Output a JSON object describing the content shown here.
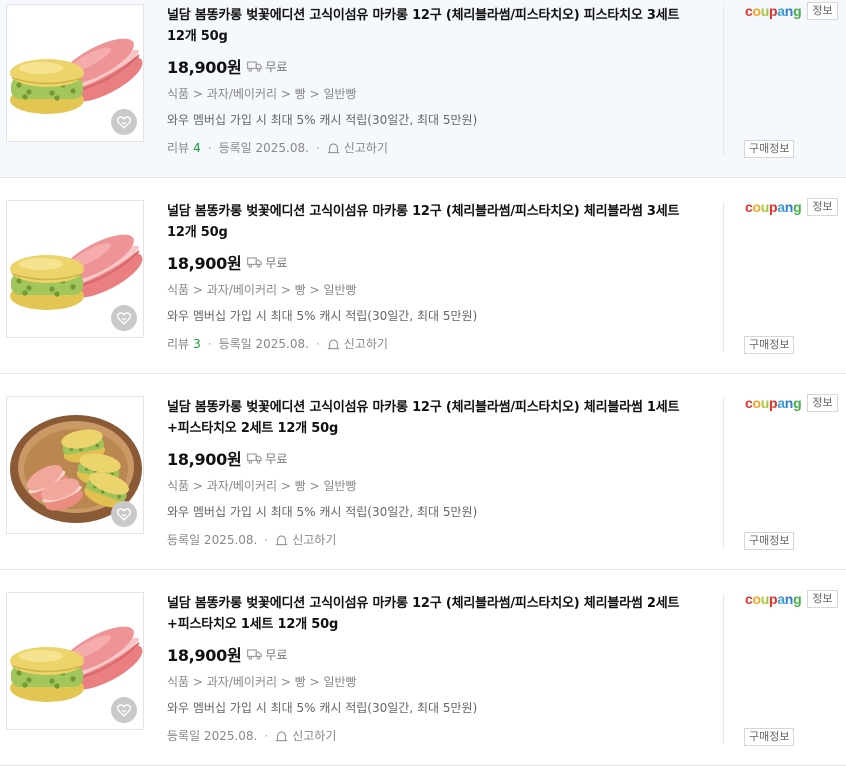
{
  "colors": {
    "price": "#111111",
    "review_count": "#1aa03a",
    "meta_text": "#888888",
    "highlight_row_bg": "#f5f8fc",
    "coupang_letters": [
      "#e0322a",
      "#f4a423",
      "#a6c63b",
      "#e0322a",
      "#3aa0d8",
      "#2f7dd1",
      "#46b04a"
    ]
  },
  "products": [
    {
      "image_icon": "macaron-stack-image",
      "zzim_icon": "heart-icon",
      "title": "널담 봄똥카롱 벚꽃에디션 고식이섬유 마카롱 12구 (체리블라썸/피스타치오) 피스타치오 3세트 12개 50g",
      "price": "18,900원",
      "shipping_icon": "truck-icon",
      "shipping": "무료",
      "category": [
        "식품",
        "과자/베이커리",
        "빵",
        "일반빵"
      ],
      "category_sep": ">",
      "benefit": "와우 멤버십 가입 시 최대 5% 캐시 적립(30일간, 최대 5만원)",
      "review_label": "리뷰",
      "review_count": "4",
      "registered": "등록일 2025.08.",
      "report": "신고하기",
      "mall_name": "coupang",
      "info_badge": "정보",
      "buy_info": "구매정보"
    },
    {
      "image_icon": "macaron-stack-image",
      "zzim_icon": "heart-icon",
      "title": "널담 봄똥카롱 벚꽃에디션 고식이섬유 마카롱 12구 (체리블라썸/피스타치오) 체리블라썸 3세트 12개 50g",
      "price": "18,900원",
      "shipping_icon": "truck-icon",
      "shipping": "무료",
      "category": [
        "식품",
        "과자/베이커리",
        "빵",
        "일반빵"
      ],
      "category_sep": ">",
      "benefit": "와우 멤버십 가입 시 최대 5% 캐시 적립(30일간, 최대 5만원)",
      "review_label": "리뷰",
      "review_count": "3",
      "registered": "등록일 2025.08.",
      "report": "신고하기",
      "mall_name": "coupang",
      "info_badge": "정보",
      "buy_info": "구매정보"
    },
    {
      "image_icon": "macaron-bowl-image",
      "zzim_icon": "heart-icon",
      "title": "널담 봄똥카롱 벚꽃에디션 고식이섬유 마카롱 12구 (체리블라썸/피스타치오) 체리블라썸 1세트+피스타치오 2세트 12개 50g",
      "price": "18,900원",
      "shipping_icon": "truck-icon",
      "shipping": "무료",
      "category": [
        "식품",
        "과자/베이커리",
        "빵",
        "일반빵"
      ],
      "category_sep": ">",
      "benefit": "와우 멤버십 가입 시 최대 5% 캐시 적립(30일간, 최대 5만원)",
      "review_label": "",
      "review_count": "",
      "registered": "등록일 2025.08.",
      "report": "신고하기",
      "mall_name": "coupang",
      "info_badge": "정보",
      "buy_info": "구매정보"
    },
    {
      "image_icon": "macaron-stack-image",
      "zzim_icon": "heart-icon",
      "title": "널담 봄똥카롱 벚꽃에디션 고식이섬유 마카롱 12구 (체리블라썸/피스타치오) 체리블라썸 2세트+피스타치오 1세트 12개 50g",
      "price": "18,900원",
      "shipping_icon": "truck-icon",
      "shipping": "무료",
      "category": [
        "식품",
        "과자/베이커리",
        "빵",
        "일반빵"
      ],
      "category_sep": ">",
      "benefit": "와우 멤버십 가입 시 최대 5% 캐시 적립(30일간, 최대 5만원)",
      "review_label": "",
      "review_count": "",
      "registered": "등록일 2025.08.",
      "report": "신고하기",
      "mall_name": "coupang",
      "info_badge": "정보",
      "buy_info": "구매정보"
    }
  ]
}
